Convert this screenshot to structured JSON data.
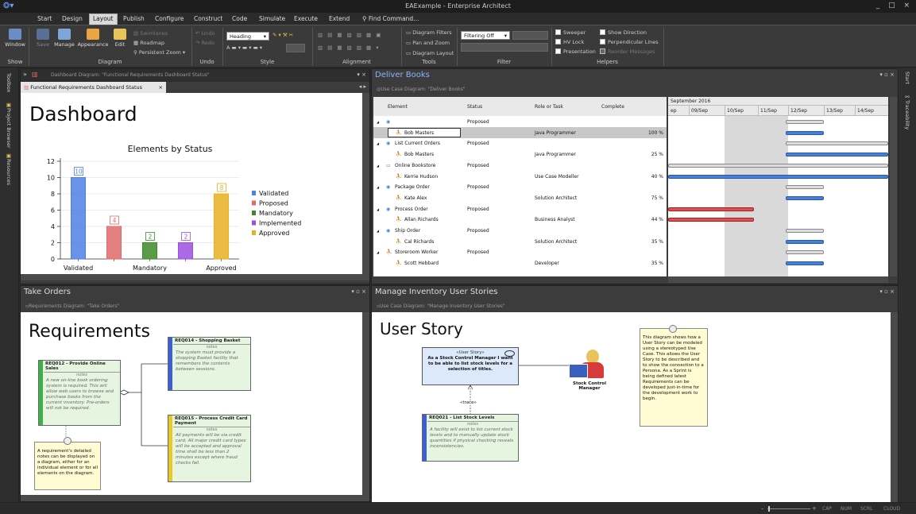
{
  "window": {
    "title": "EAExample - Enterprise Architect",
    "controls": "_ □ ×"
  },
  "menu": {
    "items": [
      "Start",
      "Design",
      "Layout",
      "Publish",
      "Configure",
      "Construct",
      "Code",
      "Simulate",
      "Execute",
      "Extend"
    ],
    "active": "Layout",
    "find_command": "Find Command..."
  },
  "ribbon": {
    "groups": [
      "Show",
      "Diagram",
      "Undo",
      "Style",
      "Alignment",
      "Tools",
      "Filter",
      "Helpers"
    ],
    "window_label": "Window",
    "save_label": "Save",
    "manage_label": "Manage",
    "appearance_label": "Appearance",
    "edit_label": "Edit",
    "swimlanes": "Swimlanes",
    "roadmap": "Roadmap",
    "persistent_zoom": "Persistent Zoom",
    "undo": "Undo",
    "redo": "Redo",
    "heading_combo": "Heading",
    "diagram_filters": "Diagram Filters",
    "pan_zoom": "Pan and Zoom",
    "diagram_layout": "Diagram Layout",
    "filtering": "Filtering Off",
    "sweeper": "Sweeper",
    "hv_lock": "HV Lock",
    "presentation": "Presentation",
    "show_direction": "Show Direction",
    "perpendicular": "Perpendicular Lines",
    "reorder": "Reorder Messages"
  },
  "leftdock": {
    "toolbox": "Toolbox",
    "project_browser": "Project Browser",
    "resources": "Resources"
  },
  "rightdock": {
    "start": "Start",
    "traceability": "Traceability"
  },
  "dashboard_panel": {
    "header": "Dashboard Diagram: \"Functional Requirements Dashboard Status\"",
    "tab": "Functional Requirements Dashboard Status",
    "title": "Dashboard"
  },
  "chart_data": {
    "type": "bar",
    "title": "Elements by Status",
    "categories": [
      "Validated",
      "Proposed",
      "Mandatory",
      "Implemented",
      "Approved"
    ],
    "x_tick_labels": [
      "Validated",
      "Mandatory",
      "Approved"
    ],
    "values": [
      10,
      4,
      2,
      2,
      8
    ],
    "colors": [
      "#4f7fe6",
      "#e06a6a",
      "#3d8a2a",
      "#9b4fe0",
      "#e8b020"
    ],
    "ylim": [
      0,
      12
    ],
    "y_ticks": [
      "0",
      "2",
      "4",
      "6",
      "8",
      "10",
      "12"
    ],
    "legend_position": "right",
    "grid": true
  },
  "deliver_panel": {
    "title": "Deliver Books",
    "sub": "Use Case Diagram: \"Deliver Books\"",
    "columns": [
      "Element",
      "Status",
      "Role or Task",
      "Complete"
    ],
    "month": "September 2016",
    "days": [
      "ep",
      "09/Sep",
      "10/Sep",
      "11/Sep",
      "12/Sep",
      "13/Sep",
      "14/Sep"
    ],
    "rows": [
      {
        "element": "",
        "status": "Proposed",
        "role": "",
        "complete": "",
        "icon": "usecase-icon"
      },
      {
        "element": "Bob Masters",
        "status": "",
        "role": "Java Programmer",
        "complete": "100 %",
        "icon": "actor-icon"
      },
      {
        "element": "List Current Orders",
        "status": "Proposed",
        "role": "",
        "complete": "",
        "icon": "usecase-icon"
      },
      {
        "element": "Bob Masters",
        "status": "",
        "role": "Java Programmer",
        "complete": "25 %",
        "icon": "actor-icon"
      },
      {
        "element": "Online Bookstore",
        "status": "Proposed",
        "role": "",
        "complete": "",
        "icon": "boundary-icon"
      },
      {
        "element": "Kerrie Hudson",
        "status": "",
        "role": "Use Case Modeller",
        "complete": "40 %",
        "icon": "actor-icon"
      },
      {
        "element": "Package Order",
        "status": "Proposed",
        "role": "",
        "complete": "",
        "icon": "usecase-icon"
      },
      {
        "element": "Kate Alex",
        "status": "",
        "role": "Solution Architect",
        "complete": "75 %",
        "icon": "actor-icon"
      },
      {
        "element": "Process Order",
        "status": "Proposed",
        "role": "",
        "complete": "",
        "icon": "usecase-icon"
      },
      {
        "element": "Allan Richards",
        "status": "",
        "role": "Business Analyst",
        "complete": "44 %",
        "icon": "actor-icon"
      },
      {
        "element": "Ship Order",
        "status": "Proposed",
        "role": "",
        "complete": "",
        "icon": "usecase-icon"
      },
      {
        "element": "Cal Richards",
        "status": "",
        "role": "Solution Architect",
        "complete": "35 %",
        "icon": "actor-icon"
      },
      {
        "element": "Storeroom Worker",
        "status": "Proposed",
        "role": "",
        "complete": "",
        "icon": "actor-icon"
      },
      {
        "element": "Scott Hebbard",
        "status": "",
        "role": "Developer",
        "complete": "35 %",
        "icon": "actor-icon"
      }
    ]
  },
  "orders_panel": {
    "title": "Take Orders",
    "sub": "Requirements Diagram: \"Take Orders\"",
    "heading": "Requirements",
    "notes_label": "notes",
    "req012": {
      "name": "REQ012 - Provide Online Sales",
      "body": "A new on-line book ordering system is required. This will allow web users to browse and purchase books from the current inventory. Pre-orders will not be required."
    },
    "req014": {
      "name": "REQ014 - Shopping Basket",
      "body": "The system must provide a shopping Basket facility that remembers the contents between sessions."
    },
    "req015": {
      "name": "REQ015 - Process Credit Card Payment",
      "body": "All payments will be via credit card. All major credit card types will be accepted and approval time shall be less than 2 minutes except where fraud checks fail."
    },
    "note": "A requirement's detailed notes can be displayed on a diagram, either for an individual element or for all elements on the diagram."
  },
  "story_panel": {
    "title": "Manage Inventory User Stories",
    "sub": "Use Case Diagram: \"Manage Inventory User Stories\"",
    "heading": "User Story",
    "story_stereo": "«User Story»",
    "story_text": "As a Stock Control Manager I want to be able to list stock levels for a selection of titles.",
    "actor": "Stock Control Manager",
    "trace": "«trace»",
    "req021": {
      "name": "REQ021 - List Stock Levels",
      "body": "A facility will exist to list current stock levels and to manually update stock quantities if physical checking reveals inconsistencies."
    },
    "note": "This diagram shows how a User Story can be modeled using a stereotyped Use Case. This allows the User Story to be described and to show the connection to a Persona. As a Sprint is being defined latest Requirements can be developed just-in-time for the development work to begin."
  },
  "statusbar": {
    "zoom_minus": "–",
    "zoom_plus": "+",
    "items": [
      "CAP",
      "NUM",
      "SCRL",
      "CLOUD"
    ]
  }
}
